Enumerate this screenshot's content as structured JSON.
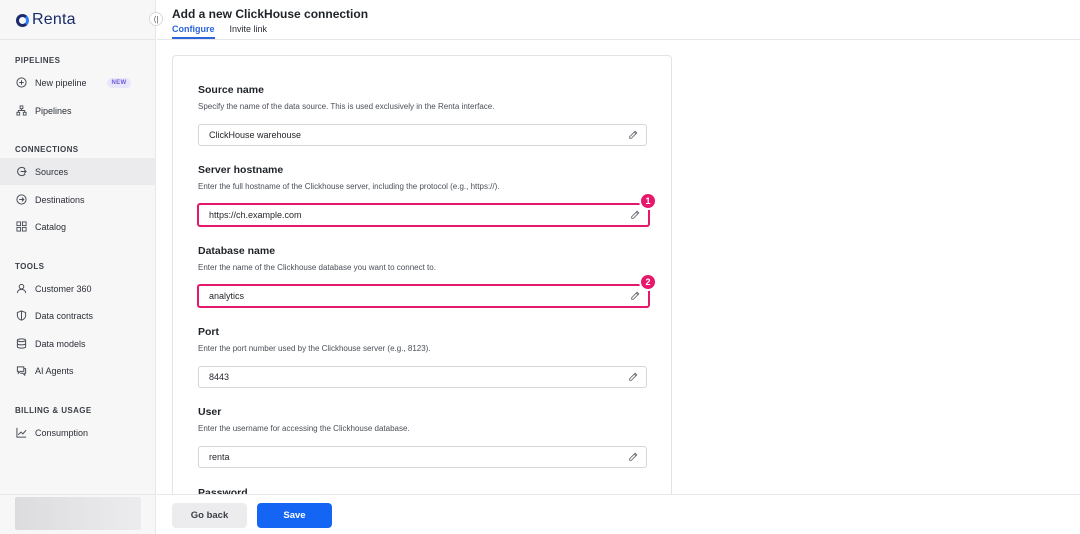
{
  "brand": {
    "name": "Renta"
  },
  "sidebar": {
    "collapse_glyph": "⟨|",
    "sections": [
      {
        "title": "PIPELINES",
        "items": [
          {
            "label": "New pipeline",
            "icon": "plus-circle-icon",
            "badge": "NEW"
          },
          {
            "label": "Pipelines",
            "icon": "sitemap-icon"
          }
        ]
      },
      {
        "title": "CONNECTIONS",
        "items": [
          {
            "label": "Sources",
            "icon": "source-icon",
            "active": true
          },
          {
            "label": "Destinations",
            "icon": "destination-icon"
          },
          {
            "label": "Catalog",
            "icon": "grid-icon"
          }
        ]
      },
      {
        "title": "TOOLS",
        "items": [
          {
            "label": "Customer 360",
            "icon": "user-icon"
          },
          {
            "label": "Data contracts",
            "icon": "shield-icon"
          },
          {
            "label": "Data models",
            "icon": "database-icon"
          },
          {
            "label": "AI Agents",
            "icon": "chat-icon"
          }
        ]
      },
      {
        "title": "BILLING & USAGE",
        "items": [
          {
            "label": "Consumption",
            "icon": "chart-line-icon"
          }
        ]
      }
    ]
  },
  "header": {
    "title": "Add a new ClickHouse connection",
    "tabs": [
      {
        "label": "Configure",
        "active": true
      },
      {
        "label": "Invite link",
        "active": false
      }
    ]
  },
  "form": {
    "fields": [
      {
        "label": "Source name",
        "description": "Specify the name of the data source. This is used exclusively in the Renta interface.",
        "value": "ClickHouse warehouse"
      },
      {
        "label": "Server hostname",
        "description": "Enter the full hostname of the Clickhouse server, including the protocol (e.g., https://).",
        "value": "https://ch.example.com",
        "marker": "1"
      },
      {
        "label": "Database name",
        "description": "Enter the name of the Clickhouse database you want to connect to.",
        "value": "analytics",
        "marker": "2"
      },
      {
        "label": "Port",
        "description": "Enter the port number used by the Clickhouse server (e.g., 8123).",
        "value": "8443"
      },
      {
        "label": "User",
        "description": "Enter the username for accessing the Clickhouse database.",
        "value": "renta"
      },
      {
        "label": "Password"
      }
    ]
  },
  "footer": {
    "back_label": "Go back",
    "save_label": "Save"
  },
  "colors": {
    "accent": "#1565f5",
    "highlight": "#e6186b",
    "tab_active": "#2a66d9"
  }
}
